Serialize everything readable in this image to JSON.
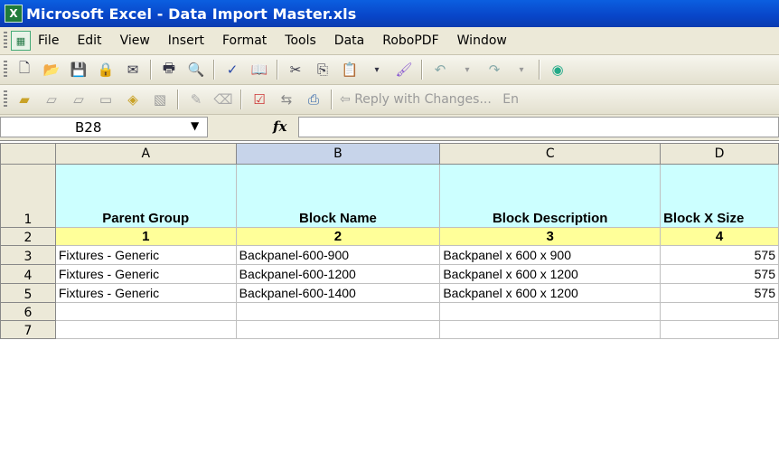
{
  "window": {
    "title": "Microsoft Excel - Data Import Master.xls"
  },
  "menu": {
    "items": [
      "File",
      "Edit",
      "View",
      "Insert",
      "Format",
      "Tools",
      "Data",
      "RoboPDF",
      "Window"
    ]
  },
  "toolbar2": {
    "reply_label": "Reply with Changes...",
    "cut_text": "En"
  },
  "formula_bar": {
    "name_box": "B28",
    "fx_symbol": "fx",
    "formula": ""
  },
  "sheet": {
    "columns": [
      "A",
      "B",
      "C",
      "D"
    ],
    "selected_column": "B",
    "rows": [
      {
        "num": "1",
        "cells": [
          "Parent Group",
          "Block Name",
          "Block Description",
          "Block X Size"
        ]
      },
      {
        "num": "2",
        "cells": [
          "1",
          "2",
          "3",
          "4"
        ]
      },
      {
        "num": "3",
        "cells": [
          "Fixtures - Generic",
          "Backpanel-600-900",
          "Backpanel x 600 x 900",
          "575"
        ]
      },
      {
        "num": "4",
        "cells": [
          "Fixtures - Generic",
          "Backpanel-600-1200",
          "Backpanel x 600 x 1200",
          "575"
        ]
      },
      {
        "num": "5",
        "cells": [
          "Fixtures - Generic",
          "Backpanel-600-1400",
          "Backpanel x 600 x 1200",
          "575"
        ]
      },
      {
        "num": "6",
        "cells": [
          "",
          "",
          "",
          ""
        ]
      },
      {
        "num": "7",
        "cells": [
          "",
          "",
          "",
          ""
        ]
      }
    ]
  },
  "colors": {
    "header_fill": "#ccffff",
    "number_row_fill": "#ffff99",
    "titlebar": "#0a4fd0"
  }
}
